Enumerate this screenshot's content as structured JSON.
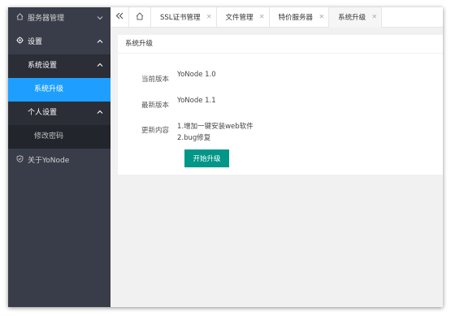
{
  "sidebar": {
    "server_mgmt": "服务器管理",
    "settings": "设置",
    "system_settings": "系统设置",
    "system_upgrade": "系统升级",
    "personal_settings": "个人设置",
    "change_password": "修改密码",
    "about": "关于YoNode"
  },
  "tabs": [
    {
      "label": "SSL证书管理"
    },
    {
      "label": "文件管理"
    },
    {
      "label": "特价服务器"
    },
    {
      "label": "系统升级",
      "active": true
    }
  ],
  "icons": {
    "collapse": "double-chevron-left-icon",
    "home": "home-icon",
    "close": "close-icon",
    "server": "home-icon",
    "settings": "gear-icon",
    "about": "shield-icon"
  },
  "card": {
    "title": "系统升级",
    "current_version_label": "当前版本",
    "current_version": "YoNode 1.0",
    "latest_version_label": "最新版本",
    "latest_version": "YoNode 1.1",
    "changes_label": "更新内容",
    "changes": [
      "1.增加一键安装web软件",
      "2.bug修复"
    ],
    "upgrade_button": "开始升级"
  },
  "colors": {
    "sidebar_bg": "#393d49",
    "active_item": "#1e9fff",
    "primary_button": "#009688"
  }
}
